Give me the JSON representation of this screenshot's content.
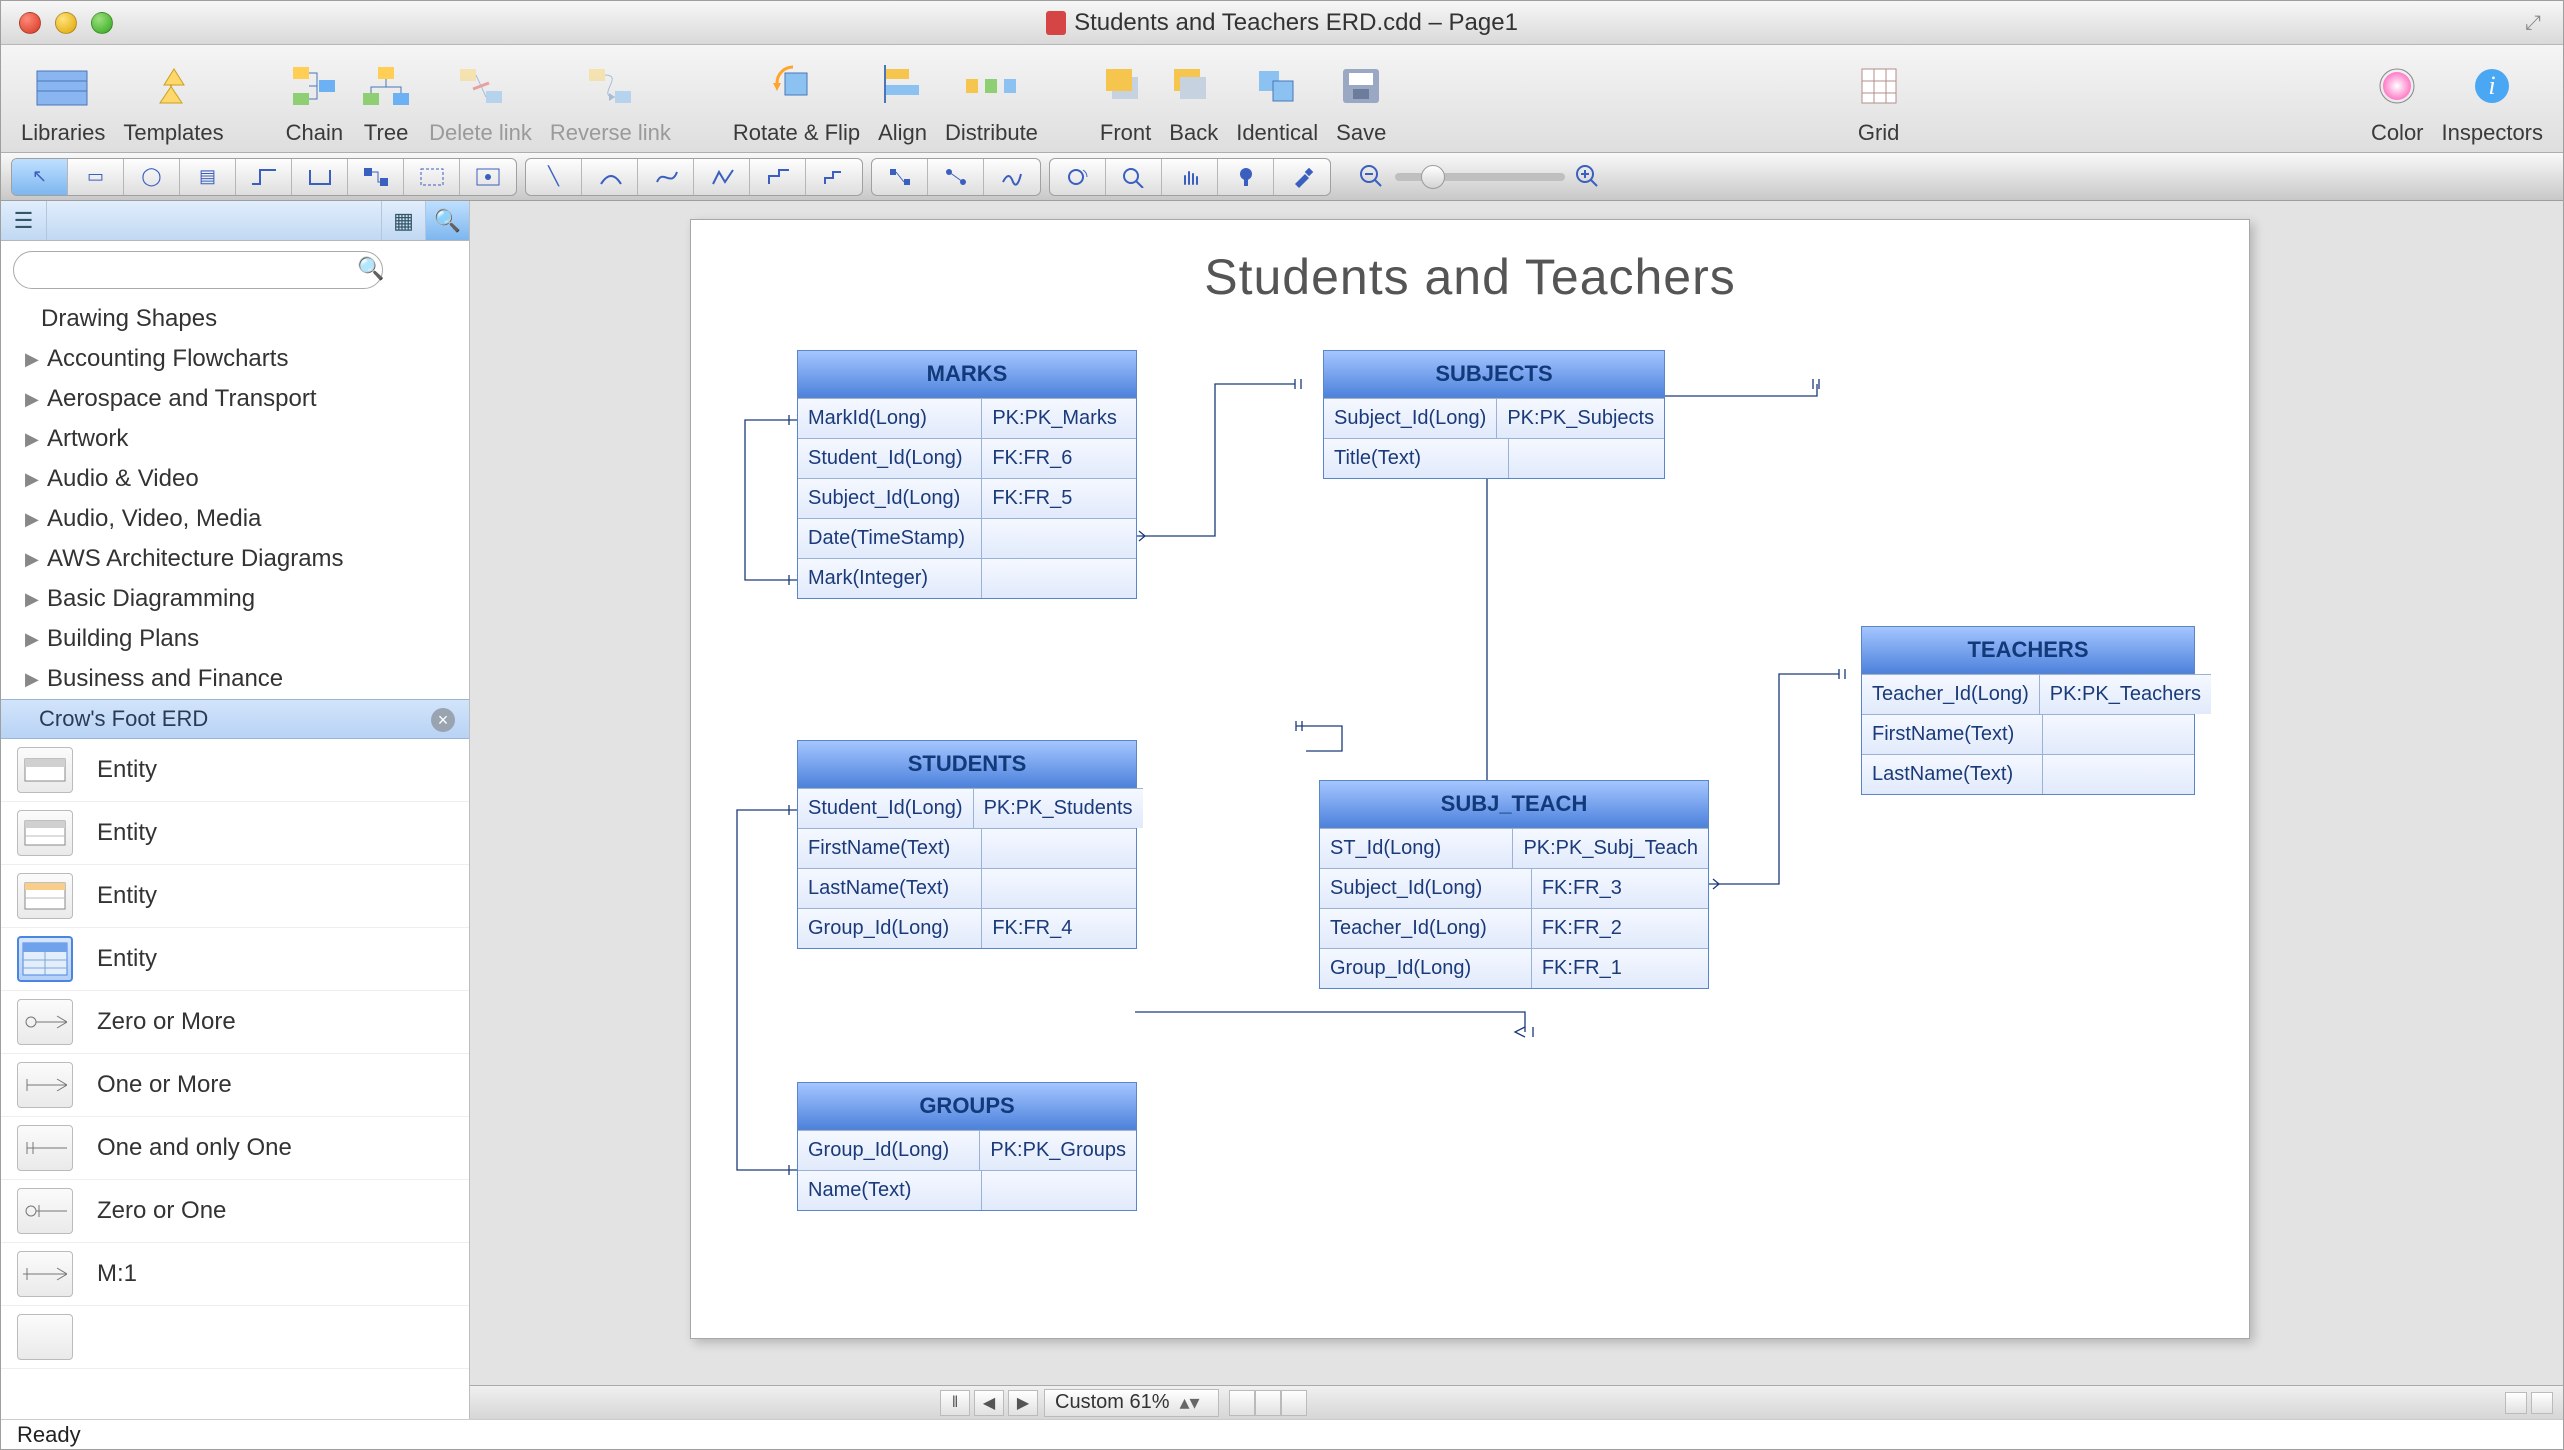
{
  "window_title": "Students and Teachers ERD.cdd – Page1",
  "toolbar": {
    "libraries": "Libraries",
    "templates": "Templates",
    "chain": "Chain",
    "tree": "Tree",
    "delete_link": "Delete link",
    "reverse_link": "Reverse link",
    "rotate_flip": "Rotate & Flip",
    "align": "Align",
    "distribute": "Distribute",
    "front": "Front",
    "back": "Back",
    "identical": "Identical",
    "save": "Save",
    "grid": "Grid",
    "color": "Color",
    "inspectors": "Inspectors"
  },
  "sidebar": {
    "categories": [
      "Drawing Shapes",
      "Accounting Flowcharts",
      "Aerospace and Transport",
      "Artwork",
      "Audio & Video",
      "Audio, Video, Media",
      "AWS Architecture Diagrams",
      "Basic Diagramming",
      "Building Plans",
      "Business and Finance"
    ],
    "selected_category": "Crow's Foot ERD",
    "shapes": [
      "Entity",
      "Entity",
      "Entity",
      "Entity",
      "Zero or More",
      "One or More",
      "One and only One",
      "Zero or One",
      "M:1"
    ]
  },
  "canvas": {
    "title": "Students and Teachers"
  },
  "entities": {
    "marks": {
      "title": "MARKS",
      "rows": [
        {
          "l": "MarkId(Long)",
          "r": "PK:PK_Marks"
        },
        {
          "l": "Student_Id(Long)",
          "r": "FK:FR_6"
        },
        {
          "l": "Subject_Id(Long)",
          "r": "FK:FR_5"
        },
        {
          "l": "Date(TimeStamp)",
          "r": ""
        },
        {
          "l": "Mark(Integer)",
          "r": ""
        }
      ]
    },
    "subjects": {
      "title": "SUBJECTS",
      "rows": [
        {
          "l": "Subject_Id(Long)",
          "r": "PK:PK_Subjects"
        },
        {
          "l": "Title(Text)",
          "r": ""
        }
      ]
    },
    "students": {
      "title": "STUDENTS",
      "rows": [
        {
          "l": "Student_Id(Long)",
          "r": "PK:PK_Students"
        },
        {
          "l": "FirstName(Text)",
          "r": ""
        },
        {
          "l": "LastName(Text)",
          "r": ""
        },
        {
          "l": "Group_Id(Long)",
          "r": "FK:FR_4"
        }
      ]
    },
    "subj_teach": {
      "title": "SUBJ_TEACH",
      "rows": [
        {
          "l": "ST_Id(Long)",
          "r": "PK:PK_Subj_Teach"
        },
        {
          "l": "Subject_Id(Long)",
          "r": "FK:FR_3"
        },
        {
          "l": "Teacher_Id(Long)",
          "r": "FK:FR_2"
        },
        {
          "l": "Group_Id(Long)",
          "r": "FK:FR_1"
        }
      ]
    },
    "teachers": {
      "title": "TEACHERS",
      "rows": [
        {
          "l": "Teacher_Id(Long)",
          "r": "PK:PK_Teachers"
        },
        {
          "l": "FirstName(Text)",
          "r": ""
        },
        {
          "l": "LastName(Text)",
          "r": ""
        }
      ]
    },
    "groups": {
      "title": "GROUPS",
      "rows": [
        {
          "l": "Group_Id(Long)",
          "r": "PK:PK_Groups"
        },
        {
          "l": "Name(Text)",
          "r": ""
        }
      ]
    }
  },
  "statusbar": {
    "ready": "Ready",
    "zoom": "Custom 61%"
  }
}
